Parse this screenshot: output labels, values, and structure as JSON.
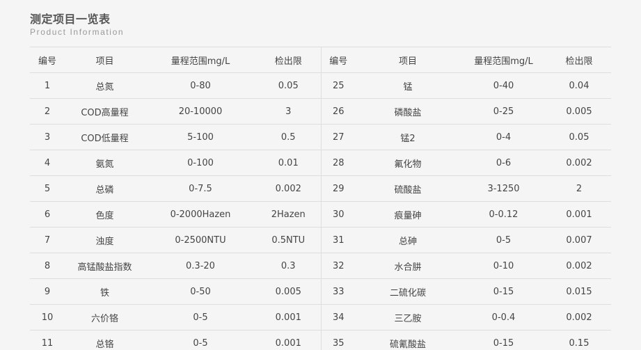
{
  "header": {
    "title": "测定项目一览表",
    "subtitle": "Product Information"
  },
  "table": {
    "columns": [
      "编号",
      "项目",
      "量程范围mg/L",
      "检出限",
      "编号",
      "项目",
      "量程范围mg/L",
      "检出限"
    ],
    "rows": [
      [
        "1",
        "总氮",
        "0-80",
        "0.05",
        "25",
        "锰",
        "0-40",
        "0.04"
      ],
      [
        "2",
        "COD高量程",
        "20-10000",
        "3",
        "26",
        "磷酸盐",
        "0-25",
        "0.005"
      ],
      [
        "3",
        "COD低量程",
        "5-100",
        "0.5",
        "27",
        "锰2",
        "0-4",
        "0.05"
      ],
      [
        "4",
        "氨氮",
        "0-100",
        "0.01",
        "28",
        "氟化物",
        "0-6",
        "0.002"
      ],
      [
        "5",
        "总磷",
        "0-7.5",
        "0.002",
        "29",
        "硫酸盐",
        "3-1250",
        "2"
      ],
      [
        "6",
        "色度",
        "0-2000Hazen",
        "2Hazen",
        "30",
        "痕量砷",
        "0-0.12",
        "0.001"
      ],
      [
        "7",
        "浊度",
        "0-2500NTU",
        "0.5NTU",
        "31",
        "总砷",
        "0-5",
        "0.007"
      ],
      [
        "8",
        "高锰酸盐指数",
        "0.3-20",
        "0.3",
        "32",
        "水合肼",
        "0-10",
        "0.002"
      ],
      [
        "9",
        "铁",
        "0-50",
        "0.005",
        "33",
        "二硫化碳",
        "0-15",
        "0.015"
      ],
      [
        "10",
        "六价铬",
        "0-5",
        "0.001",
        "34",
        "三乙胺",
        "0-0.4",
        "0.002"
      ],
      [
        "11",
        "总铬",
        "0-5",
        "0.001",
        "35",
        "硫氰酸盐",
        "0-15",
        "0.15"
      ]
    ]
  }
}
